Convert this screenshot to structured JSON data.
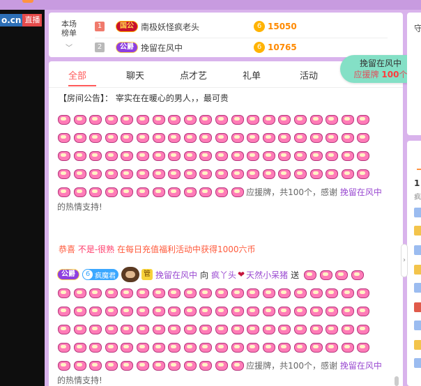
{
  "brand": {
    "domain_fragment": "o.cn",
    "live_label": "直播"
  },
  "rank": {
    "title": "本场榜单",
    "entries": [
      {
        "rank": "1",
        "badge": "国公",
        "name": "南极妖怪疯老头",
        "score": "15050"
      },
      {
        "rank": "2",
        "badge": "公爵",
        "name": "挽留在风中",
        "score": "10765"
      }
    ],
    "coin_glyph": "6"
  },
  "tabs": [
    {
      "label": "全部",
      "active": true
    },
    {
      "label": "聊天",
      "active": false
    },
    {
      "label": "点才艺",
      "active": false
    },
    {
      "label": "礼单",
      "active": false
    },
    {
      "label": "活动",
      "active": false
    }
  ],
  "notice": {
    "tag": "【房间公告】：",
    "text": "宰实在在暖心的男人，，最可贵"
  },
  "support_pill": {
    "name": "挽留在风中",
    "prefix": "应援牌",
    "count": "100",
    "unit": "个"
  },
  "message1": {
    "text_before": "应援牌，共100个，感谢",
    "user": "挽留在风中",
    "tail": "的热情支持!"
  },
  "system": {
    "prefix": "恭喜",
    "user": "不是-很熟",
    "text": "在每日充值福利活动中获得1000六币"
  },
  "gift": {
    "sender_badge": "公爵",
    "level_num": "6",
    "level_label": "疯魔君",
    "guan": "管",
    "sender": "挽留在风中",
    "to_word": "向",
    "receiver": "疯丫头",
    "receiver2": "天然小呆猪",
    "send_word": "送",
    "text_before": "应援牌，共100个，感谢",
    "user": "挽留在风中",
    "tail": "的热情支持!"
  },
  "right_panel": {
    "top_char": "守",
    "rank_num": "1",
    "sub": "疯"
  },
  "colors": {
    "accent": "#ff5a5a",
    "purple": "#9a4ad1",
    "bg": "#d9b3ec",
    "gold": "#ff8a00",
    "mint": "#84e0c6"
  }
}
